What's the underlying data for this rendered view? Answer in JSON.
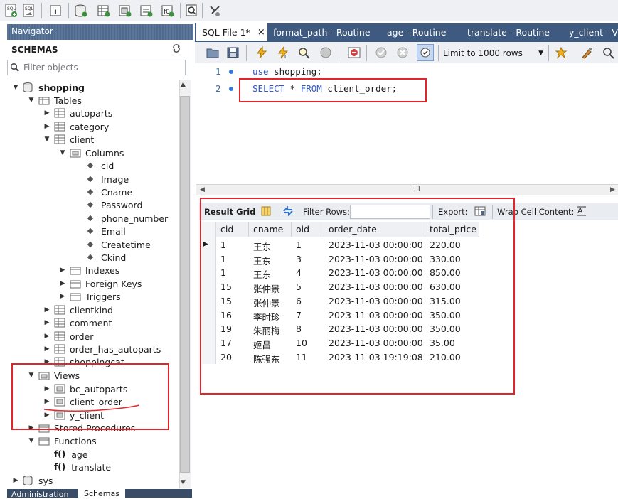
{
  "toolbar": {
    "icons": [
      "new-sql-tab-icon",
      "open-sql-script-icon",
      "inspector-icon",
      "create-schema-icon",
      "create-table-icon",
      "create-view-icon",
      "create-procedure-icon",
      "create-function-icon",
      "search-table-icon",
      "reconnect-icon"
    ]
  },
  "navigator": {
    "header": "Navigator",
    "schemas_title": "SCHEMAS",
    "filter_placeholder": "Filter objects",
    "tree": {
      "shopping": "shopping",
      "tables": "Tables",
      "autoparts": "autoparts",
      "category": "category",
      "client": "client",
      "columns": "Columns",
      "col_cid": "cid",
      "col_image": "Image",
      "col_cname": "Cname",
      "col_password": "Password",
      "col_phone": "phone_number",
      "col_email": "Email",
      "col_createtime": "Createtime",
      "col_ckind": "Ckind",
      "indexes": "Indexes",
      "foreign_keys": "Foreign Keys",
      "triggers": "Triggers",
      "clientkind": "clientkind",
      "comment": "comment",
      "order": "order",
      "order_has_autoparts": "order_has_autoparts",
      "shoppingcat": "shoppingcat",
      "views": "Views",
      "bc_autoparts": "bc_autoparts",
      "client_order": "client_order",
      "y_client": "y_client",
      "stored_procedures": "Stored Procedures",
      "functions": "Functions",
      "fn_age": "age",
      "fn_translate": "translate",
      "fn_prefix": "f()",
      "sys": "sys"
    },
    "bottom_tabs": [
      "Administration",
      "Schemas"
    ]
  },
  "tabs": [
    {
      "label": "SQL File 1*"
    },
    {
      "label": "format_path - Routine"
    },
    {
      "label": "age - Routine"
    },
    {
      "label": "translate - Routine"
    },
    {
      "label": "y_client - Vi"
    }
  ],
  "editor": {
    "limit_label": "Limit to 1000 rows",
    "lines": [
      {
        "num": "1",
        "kw": "use",
        "rest": " shopping;"
      },
      {
        "num": "2",
        "kw1": "SELECT",
        "mid": " * ",
        "kw2": "FROM",
        "rest": " client_order;"
      }
    ],
    "scroll_marker": "III"
  },
  "results": {
    "result_grid": "Result Grid",
    "filter_rows": "Filter Rows:",
    "export": "Export:",
    "wrap": "Wrap Cell Content:",
    "columns": [
      "cid",
      "cname",
      "oid",
      "order_date",
      "total_price"
    ],
    "rows": [
      [
        "1",
        "王东",
        "1",
        "2023-11-03 00:00:00",
        "220.00"
      ],
      [
        "1",
        "王东",
        "3",
        "2023-11-03 00:00:00",
        "330.00"
      ],
      [
        "1",
        "王东",
        "4",
        "2023-11-03 00:00:00",
        "850.00"
      ],
      [
        "15",
        "张仲景",
        "5",
        "2023-11-03 00:00:00",
        "630.00"
      ],
      [
        "15",
        "张仲景",
        "6",
        "2023-11-03 00:00:00",
        "315.00"
      ],
      [
        "16",
        "李时珍",
        "7",
        "2023-11-03 00:00:00",
        "350.00"
      ],
      [
        "19",
        "朱丽梅",
        "8",
        "2023-11-03 00:00:00",
        "350.00"
      ],
      [
        "17",
        "姬昌",
        "10",
        "2023-11-03 00:00:00",
        "35.00"
      ],
      [
        "20",
        "陈强东",
        "11",
        "2023-11-03 19:19:08",
        "210.00"
      ]
    ]
  },
  "colors": {
    "nav_header": "#4e6a8e",
    "tab_strip": "#3f5a80",
    "annotation_red": "#e1262b",
    "keyword_blue": "#2f56c8"
  }
}
